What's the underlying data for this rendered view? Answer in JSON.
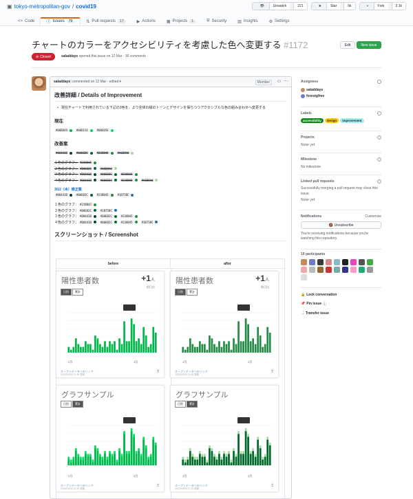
{
  "repo": {
    "owner": "tokyo-metropolitan-gov",
    "name": "covid19"
  },
  "repo_actions": [
    {
      "label": "Unwatch",
      "count": "221"
    },
    {
      "label": "Star",
      "count": "6k"
    },
    {
      "label": "Fork",
      "count": "2.1k"
    }
  ],
  "tabs": [
    {
      "label": "Code",
      "count": ""
    },
    {
      "label": "Issues",
      "count": "79"
    },
    {
      "label": "Pull requests",
      "count": "17"
    },
    {
      "label": "Actions",
      "count": ""
    },
    {
      "label": "Projects",
      "count": "1"
    },
    {
      "label": "Security",
      "count": ""
    },
    {
      "label": "Insights",
      "count": ""
    },
    {
      "label": "Settings",
      "count": ""
    }
  ],
  "issue": {
    "title": "チャートのカラーをアクセシビリティを考慮した色へ変更する",
    "number": "#1172",
    "state": "Closed",
    "author": "saladdays",
    "meta": "opened this issue on 12 Mar · 36 comments",
    "edit_label": "Edit",
    "new_label": "New issue"
  },
  "comment": {
    "author": "saladdays",
    "meta": "commented on 12 Mar · edited",
    "role": "Member",
    "h_details": "改善詳細 / Details of Improvement",
    "bullet": "現在チャートで利用されている下記の3色を、より全体の緑のトーンとデザインを保ちつつアクセシブルな色の組み合わせへ変更する",
    "h_current": "現在",
    "current": [
      "#00B849",
      "#00D154",
      "#00E05E"
    ],
    "h_proposal": "改善案",
    "proposal": [
      "#00441B",
      "#00682C",
      "#238B45",
      "#A6D8A0"
    ],
    "old_rows": [
      {
        "label": "１色のグラフ：",
        "codes": [
          "#238B45"
        ]
      },
      {
        "label": "２色のグラフ：",
        "codes": [
          "#00682C",
          "#A6D8A0"
        ]
      },
      {
        "label": "３色のグラフ：",
        "codes": [
          "#00441B",
          "#00682C",
          "#238B45"
        ]
      },
      {
        "label": "４色のグラフ：",
        "codes": [
          "#00441B",
          "#00682C",
          "#238B45",
          "#A6D8A0"
        ]
      }
    ],
    "revision_note": "3/12（木）修正案",
    "revised": [
      "#00441B",
      "#00682C",
      "#238B45",
      "#1B75BC"
    ],
    "new_rows": [
      {
        "label": "１色のグラフ：",
        "codes": [
          "#238B45"
        ]
      },
      {
        "label": "２色のグラフ：",
        "codes": [
          "#00682C",
          "#1B75BC"
        ]
      },
      {
        "label": "３色のグラフ：",
        "codes": [
          "#00441B",
          "#00682C",
          "#238B45"
        ]
      },
      {
        "label": "４色のグラフ：",
        "codes": [
          "#00441B",
          "#00682C",
          "#238B45",
          "#1B75BC"
        ]
      }
    ],
    "h_screens": "スクリーンショット / Screenshot",
    "col_before": "before",
    "col_after": "after"
  },
  "cards": {
    "t1": "陽性患者数",
    "t2": "グラフサンプル",
    "plus": "+1",
    "unit": "人",
    "upd": "前日比",
    "tag1": "日別",
    "tag2": "累計",
    "link": "オープンデータへのリンク",
    "date": "2020/03/08 12:45 更新",
    "tooltip": "2/6/2020\n日別"
  },
  "chart_data": [
    {
      "type": "bar",
      "values": [
        2,
        1,
        2,
        5,
        3,
        2,
        2,
        4,
        3,
        3,
        1,
        6,
        5,
        3,
        2,
        4,
        2,
        4,
        3,
        4,
        1,
        5,
        3,
        11,
        4,
        4,
        12,
        10,
        4,
        5,
        3,
        9,
        6,
        2,
        3,
        9,
        7
      ]
    },
    {
      "type": "bar",
      "values": [
        2,
        1,
        2,
        5,
        3,
        2,
        2,
        4,
        3,
        3,
        1,
        6,
        5,
        3,
        2,
        4,
        2,
        4,
        3,
        4,
        1,
        5,
        3,
        11,
        4,
        4,
        12,
        10,
        4,
        5,
        3,
        9,
        6,
        2,
        3,
        9,
        7
      ]
    },
    {
      "type": "bar",
      "series": [
        {
          "name": "日別",
          "values": [
            2,
            1,
            2,
            5,
            3,
            2,
            2,
            4,
            3,
            3,
            1,
            6,
            5,
            3,
            2,
            4,
            2,
            4,
            3,
            4,
            1,
            5,
            3,
            11,
            4,
            4,
            12,
            10,
            4,
            5,
            3,
            9,
            6,
            2,
            3,
            9,
            7
          ]
        },
        {
          "name": "累計",
          "values": [
            3,
            2,
            3,
            6,
            4,
            3,
            3,
            5,
            4,
            4,
            2,
            7,
            6,
            4,
            3,
            5,
            3,
            5,
            4,
            5,
            2,
            6,
            4,
            12,
            5,
            5,
            13,
            11,
            5,
            6,
            4,
            10,
            7,
            3,
            4,
            10,
            8
          ]
        }
      ]
    }
  ],
  "colors": {
    "green1": "#00B849",
    "green2": "#00D154",
    "green3": "#00E05E",
    "c1": "#00441B",
    "c2": "#00682C",
    "c3": "#238B45",
    "c4": "#A6D8A0",
    "c5": "#1B75BC",
    "closed": "#cb2431",
    "new_issue": "#2ea44f"
  },
  "sidebar": {
    "assignees_title": "Assignees",
    "assignees": [
      "saladdays",
      "forestgfree"
    ],
    "labels_title": "Labels",
    "labels": [
      {
        "name": "accessibility",
        "color": "#0e8a16",
        "fg": "#fff"
      },
      {
        "name": "design",
        "color": "#fbca04",
        "fg": "#24292e"
      },
      {
        "name": "improvement",
        "color": "#a2eeef",
        "fg": "#24292e"
      }
    ],
    "projects_title": "Projects",
    "projects_val": "None yet",
    "milestone_title": "Milestone",
    "milestone_val": "No milestone",
    "linked_title": "Linked pull requests",
    "linked_text": "Successfully merging a pull request may close this issue.",
    "linked_val": "None yet",
    "notif_title": "Notifications",
    "customize": "Customize",
    "unsubscribe": "Unsubscribe",
    "notif_text": "You're receiving notifications because you're watching this repository.",
    "participants_title": "19 participants",
    "lock": "Lock conversation",
    "pin": "Pin issue",
    "transfer": "Transfer issue"
  }
}
